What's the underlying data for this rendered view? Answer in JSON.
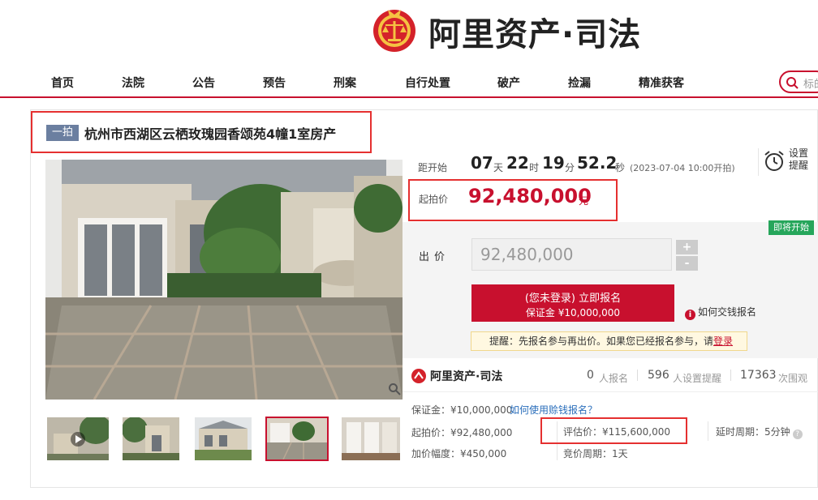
{
  "brand": {
    "name": "阿里资产·司法",
    "mini_name": "阿里资产·司法"
  },
  "nav": {
    "items": [
      "首页",
      "法院",
      "公告",
      "预告",
      "刑案",
      "自行处置",
      "破产",
      "捡漏",
      "精准获客"
    ],
    "search_placeholder": "标的"
  },
  "lot": {
    "badge": "一拍",
    "title": "杭州市西湖区云栖玫瑰园香颂苑4幢1室房产"
  },
  "countdown": {
    "label": "距开始",
    "days": "07",
    "days_unit": "天",
    "hours": "22",
    "hours_unit": "时",
    "minutes": "19",
    "minutes_unit": "分",
    "seconds": "52.2",
    "seconds_unit": "秒",
    "start_time": "(2023-07-04 10:00开拍)",
    "reminder_label": "设置提醒"
  },
  "price": {
    "label": "起拍价",
    "value": "92,480,000",
    "unit": "元"
  },
  "bid": {
    "status_badge": "即将开始",
    "label": "出价",
    "input_value": "92,480,000",
    "plus": "+",
    "minus": "-",
    "signup_line1": "(您未登录) 立即报名",
    "signup_line2": "保证金 ¥10,000,000",
    "deposit_help": "如何交钱报名",
    "tip_text": "提醒：先报名参与再出价。如果您已经报名参与，请",
    "tip_link": "登录"
  },
  "stats": {
    "registered_count": "0",
    "registered_label": "人报名",
    "reminders_count": "596",
    "reminders_label": "人设置提醒",
    "views_count": "17363",
    "views_label": "次围观"
  },
  "details": {
    "deposit": "保证金：¥10,000,000",
    "deposit_link": "如何使用赊钱报名？",
    "start_price": "起拍价：¥92,480,000",
    "increment": "加价幅度：¥450,000",
    "appraisal": "评估价：¥115,600,000",
    "bid_cycle": "竞价周期：1天",
    "extension": "延时周期：5分钟"
  },
  "colors": {
    "accent": "#c8102e",
    "badge": "#6b7fa0",
    "green": "#26a65b",
    "highlight": "#e53030"
  }
}
